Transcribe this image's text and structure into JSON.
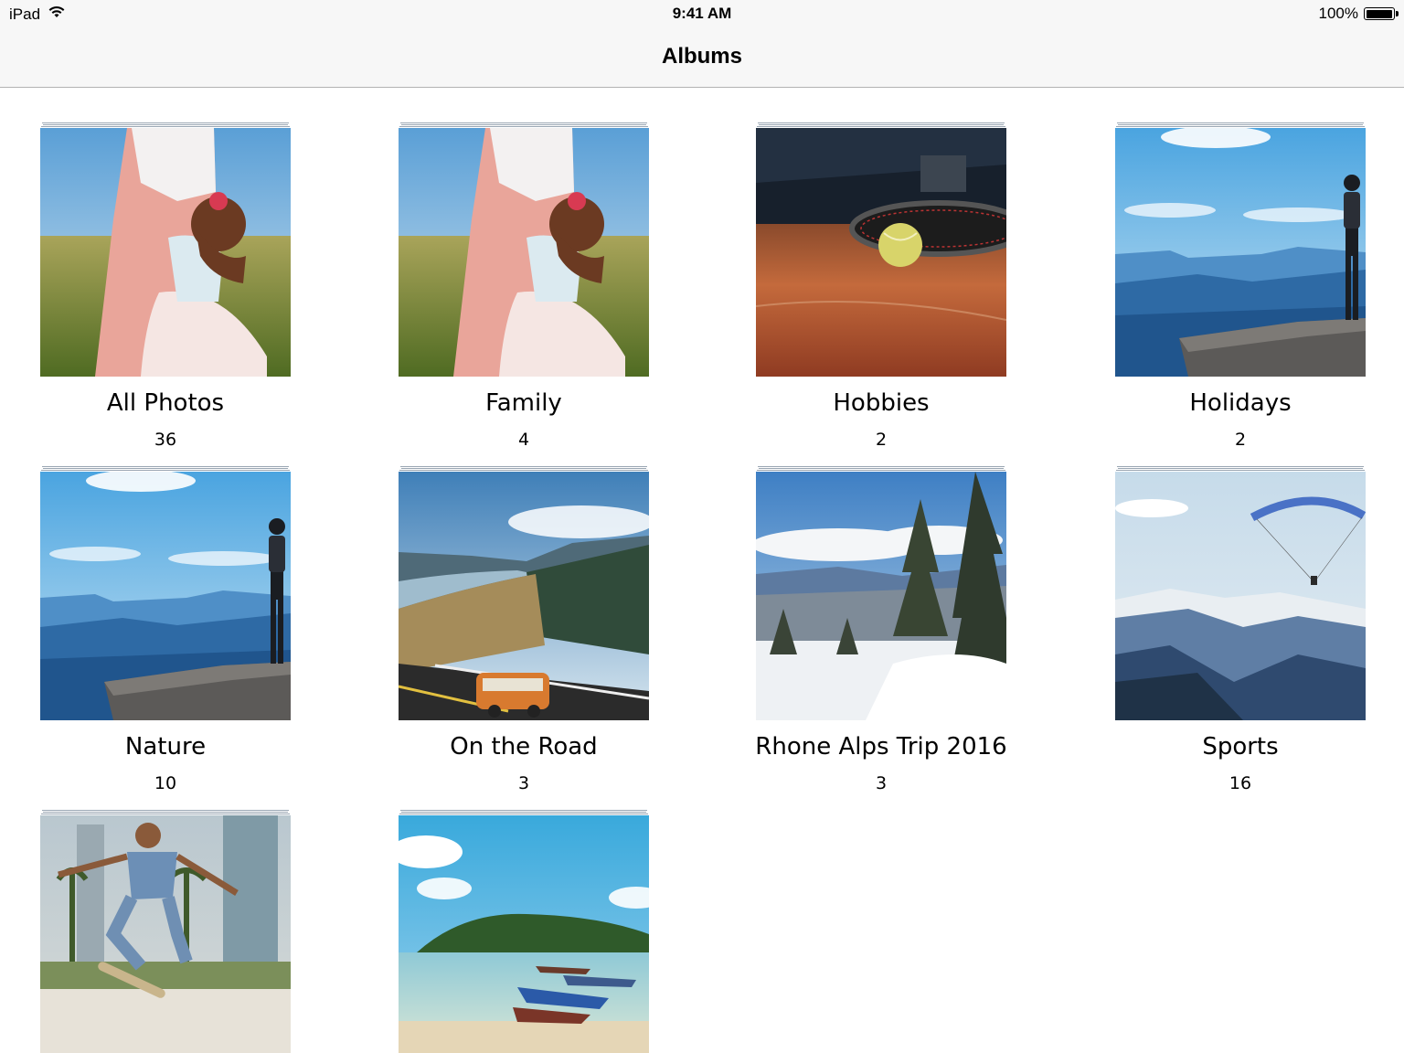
{
  "status_bar": {
    "device": "iPad",
    "time": "9:41 AM",
    "battery": "100%",
    "battery_level": 1.0
  },
  "nav": {
    "title": "Albums"
  },
  "albums": [
    {
      "title": "All Photos",
      "count": "36",
      "thumbnail": "mother-and-daughter-in-field"
    },
    {
      "title": "Family",
      "count": "4",
      "thumbnail": "mother-and-daughter-in-field"
    },
    {
      "title": "Hobbies",
      "count": "2",
      "thumbnail": "tennis-racket-and-ball"
    },
    {
      "title": "Holidays",
      "count": "2",
      "thumbnail": "canyon-cliff-person"
    },
    {
      "title": "Nature",
      "count": "10",
      "thumbnail": "canyon-cliff-person"
    },
    {
      "title": "On the Road",
      "count": "3",
      "thumbnail": "river-valley-van"
    },
    {
      "title": "Rhone Alps Trip 2016",
      "count": "3",
      "thumbnail": "snowy-pine-forest"
    },
    {
      "title": "Sports",
      "count": "16",
      "thumbnail": "paraglider-over-mountains"
    },
    {
      "title": "",
      "count": "",
      "thumbnail": "skateboarder-jump"
    },
    {
      "title": "",
      "count": "",
      "thumbnail": "tropical-island-boats"
    }
  ]
}
